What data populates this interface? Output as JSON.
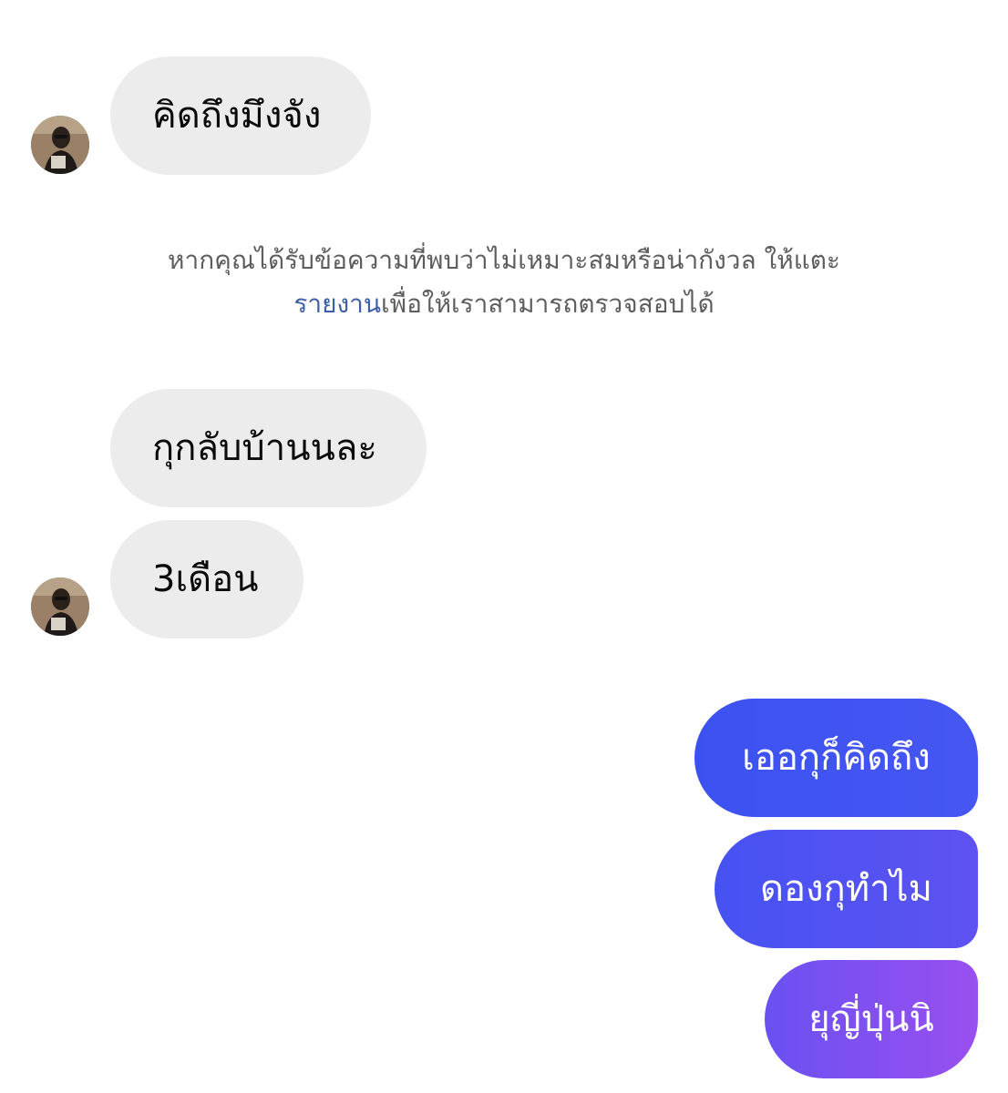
{
  "incoming": [
    {
      "text": "คิดถึงมึงจัง",
      "has_avatar": true
    },
    {
      "text": "กุกลับบ้านนละ",
      "has_avatar": false
    },
    {
      "text": "3เดือน",
      "has_avatar": true
    }
  ],
  "notice": {
    "line1": "หากคุณได้รับข้อความที่พบว่าไม่เหมาะสมหรือน่ากังวล ให้แตะ",
    "link": "รายงาน",
    "line2_rest": "เพื่อให้เราสามารถตรวจสอบได้"
  },
  "outgoing": [
    {
      "text": "เออกุก็คิดถึง"
    },
    {
      "text": "ดองกุทำไม"
    },
    {
      "text": "ยุญี่ปุ่นนิ"
    }
  ],
  "colors": {
    "incoming_bubble": "#ececec",
    "outgoing_gradient_start": "#3b55f2",
    "outgoing_gradient_end": "#9b4ff0",
    "link": "#3d5fa8"
  },
  "icons": {
    "avatar": "profile-photo-avatar"
  }
}
